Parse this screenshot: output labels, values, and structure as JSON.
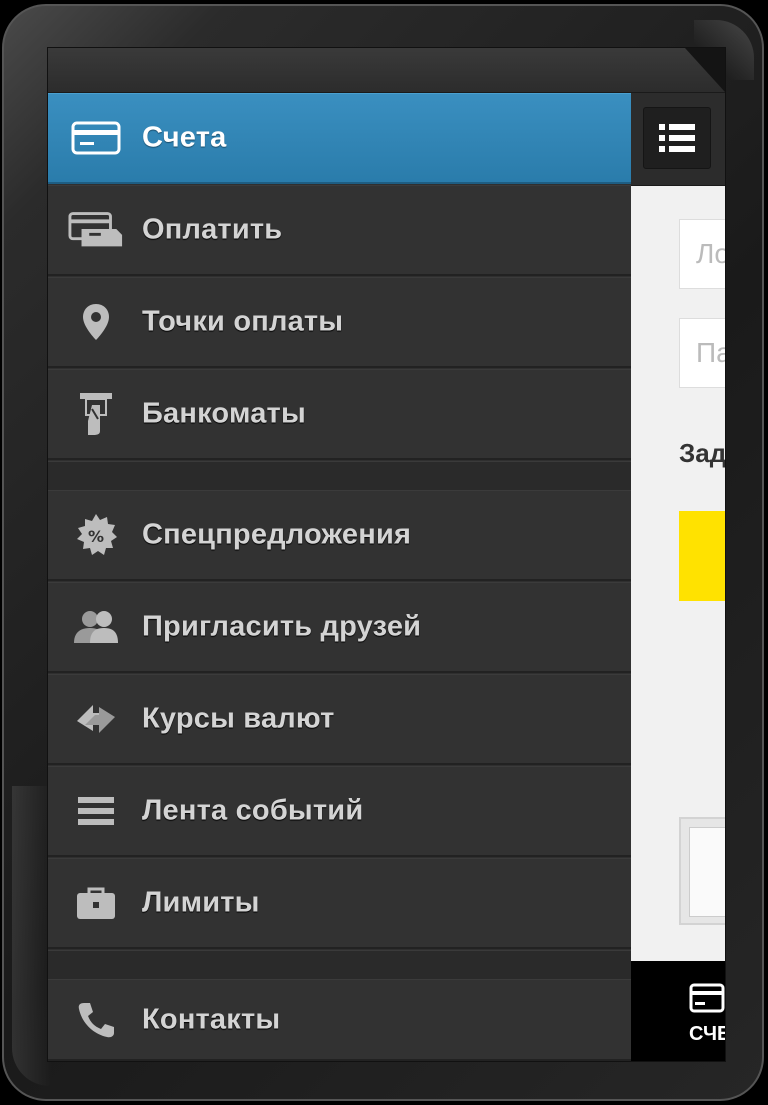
{
  "menu": {
    "items": [
      {
        "label": "Счета",
        "icon": "card-icon",
        "active": true
      },
      {
        "label": "Оплатить",
        "icon": "payment-icon"
      },
      {
        "label": "Точки оплаты",
        "icon": "location-pin-icon"
      },
      {
        "label": "Банкоматы",
        "icon": "atm-icon"
      },
      {
        "label": "Спецпредложения",
        "icon": "percent-badge-icon"
      },
      {
        "label": "Пригласить друзей",
        "icon": "users-icon"
      },
      {
        "label": "Курсы валют",
        "icon": "exchange-icon"
      },
      {
        "label": "Лента событий",
        "icon": "list-icon"
      },
      {
        "label": "Лимиты",
        "icon": "briefcase-icon"
      },
      {
        "label": "Контакты",
        "icon": "phone-icon"
      }
    ]
  },
  "content": {
    "login_placeholder": "Ло",
    "password_placeholder": "Па",
    "forgot_text": "Зад",
    "tab_label": "СЧЕ"
  },
  "colors": {
    "active_item": "#2a7cab",
    "accent_button": "#ffe200",
    "drawer_background": "#323232"
  }
}
